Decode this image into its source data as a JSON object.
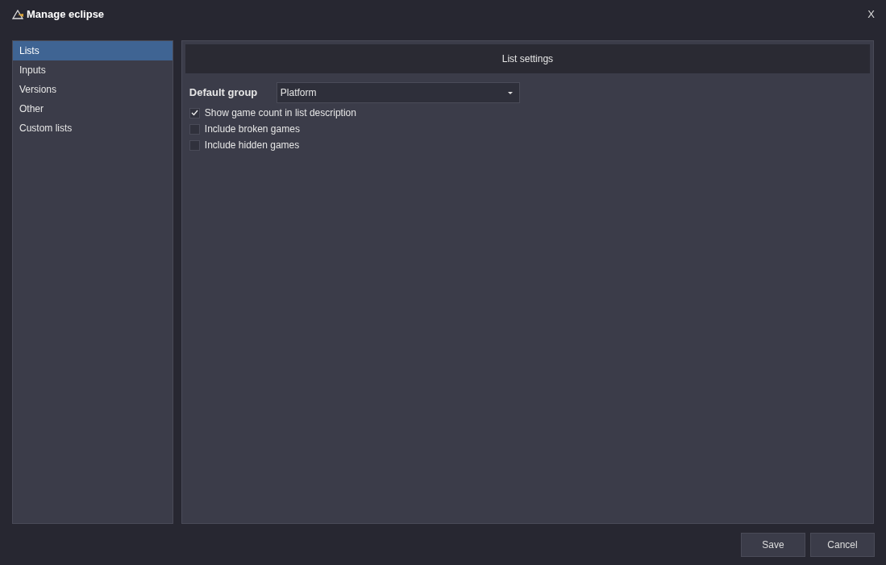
{
  "window": {
    "title": "Manage eclipse",
    "close": "X"
  },
  "sidebar": {
    "items": [
      {
        "label": "Lists",
        "selected": true
      },
      {
        "label": "Inputs",
        "selected": false
      },
      {
        "label": "Versions",
        "selected": false
      },
      {
        "label": "Other",
        "selected": false
      },
      {
        "label": "Custom lists",
        "selected": false
      }
    ]
  },
  "panel": {
    "header": "List settings",
    "default_group": {
      "label": "Default group",
      "value": "Platform"
    },
    "options": [
      {
        "label": "Show game count in list description",
        "checked": true
      },
      {
        "label": "Include broken games",
        "checked": false
      },
      {
        "label": "Include hidden games",
        "checked": false
      }
    ]
  },
  "buttons": [
    "Save",
    "Cancel"
  ]
}
